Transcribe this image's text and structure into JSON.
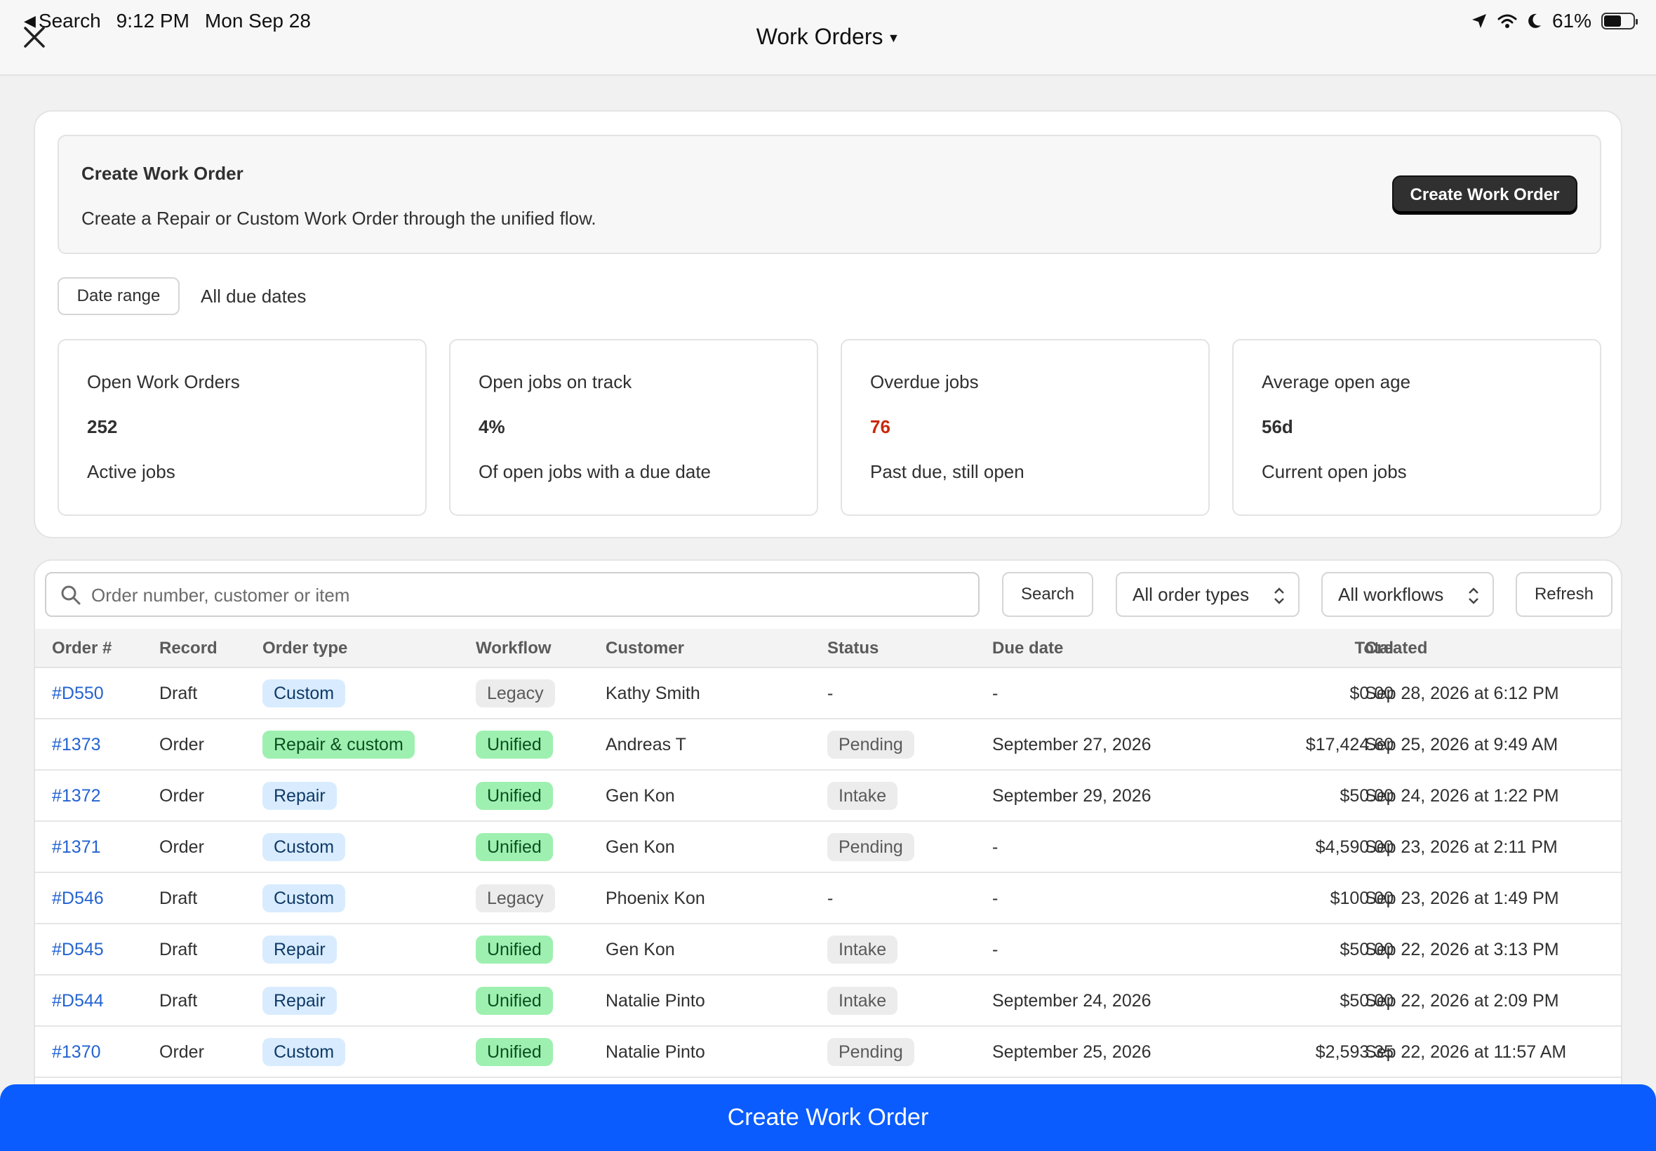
{
  "status_bar": {
    "back_label": "Search",
    "time": "9:12 PM",
    "date": "Mon Sep 28",
    "battery": "61%",
    "battery_level": 0.61
  },
  "nav": {
    "title": "Work Orders"
  },
  "create_panel": {
    "heading": "Create Work Order",
    "description": "Create a Repair or Custom Work Order through the unified flow.",
    "button_label": "Create Work Order"
  },
  "filter": {
    "date_range_label": "Date range",
    "date_value": "All due dates"
  },
  "metrics": [
    {
      "title": "Open Work Orders",
      "value": "252",
      "sub": "Active jobs"
    },
    {
      "title": "Open jobs on track",
      "value": "4%",
      "sub": "Of open jobs with a due date"
    },
    {
      "title": "Overdue jobs",
      "value": "76",
      "sub": "Past due, still open"
    },
    {
      "title": "Average open age",
      "value": "56d",
      "sub": "Current open jobs"
    }
  ],
  "toolbar": {
    "search_placeholder": "Order number, customer or item",
    "search_button": "Search",
    "order_type_select": "All order types",
    "workflow_select": "All workflows",
    "refresh_button": "Refresh"
  },
  "table": {
    "headers": {
      "order": "Order #",
      "record": "Record",
      "type": "Order type",
      "workflow": "Workflow",
      "customer": "Customer",
      "status": "Status",
      "due": "Due date",
      "total": "Total",
      "created": "Created"
    },
    "rows": [
      {
        "order": "#D550",
        "record": "Draft",
        "type": "Custom",
        "workflow": "Legacy",
        "customer": "Kathy Smith",
        "status": "-",
        "due": "-",
        "total": "$0.00",
        "created": "Sep 28, 2026 at 6:12 PM"
      },
      {
        "order": "#1373",
        "record": "Order",
        "type": "Repair & custom",
        "workflow": "Unified",
        "customer": "Andreas T",
        "status": "Pending",
        "due": "September 27, 2026",
        "total": "$17,424.60",
        "created": "Sep 25, 2026 at 9:49 AM"
      },
      {
        "order": "#1372",
        "record": "Order",
        "type": "Repair",
        "workflow": "Unified",
        "customer": "Gen Kon",
        "status": "Intake",
        "due": "September 29, 2026",
        "total": "$50.00",
        "created": "Sep 24, 2026 at 1:22 PM"
      },
      {
        "order": "#1371",
        "record": "Order",
        "type": "Custom",
        "workflow": "Unified",
        "customer": "Gen Kon",
        "status": "Pending",
        "due": "-",
        "total": "$4,590.00",
        "created": "Sep 23, 2026 at 2:11 PM"
      },
      {
        "order": "#D546",
        "record": "Draft",
        "type": "Custom",
        "workflow": "Legacy",
        "customer": "Phoenix Kon",
        "status": "-",
        "due": "-",
        "total": "$100.00",
        "created": "Sep 23, 2026 at 1:49 PM"
      },
      {
        "order": "#D545",
        "record": "Draft",
        "type": "Repair",
        "workflow": "Unified",
        "customer": "Gen Kon",
        "status": "Intake",
        "due": "-",
        "total": "$50.00",
        "created": "Sep 22, 2026 at 3:13 PM"
      },
      {
        "order": "#D544",
        "record": "Draft",
        "type": "Repair",
        "workflow": "Unified",
        "customer": "Natalie Pinto",
        "status": "Intake",
        "due": "September 24, 2026",
        "total": "$50.00",
        "created": "Sep 22, 2026 at 2:09 PM"
      },
      {
        "order": "#1370",
        "record": "Order",
        "type": "Custom",
        "workflow": "Unified",
        "customer": "Natalie Pinto",
        "status": "Pending",
        "due": "September 25, 2026",
        "total": "$2,593.35",
        "created": "Sep 22, 2026 at 11:57 AM"
      }
    ]
  },
  "bottom_button": "Create Work Order",
  "colors": {
    "primary_blue": "#0a5cff",
    "link_blue": "#2463d1",
    "overdue_red": "#c9290c",
    "dark_button": "#303030"
  }
}
